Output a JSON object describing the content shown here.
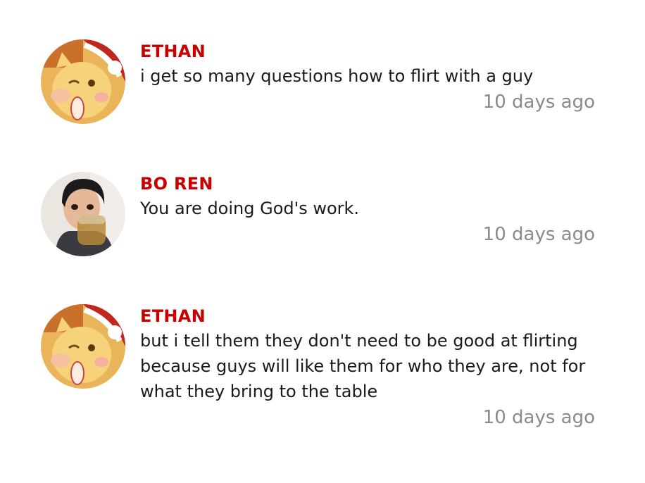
{
  "comments": [
    {
      "author": "ETHAN",
      "text": "i get so many questions how to flirt with a guy",
      "time": "10 days ago",
      "avatar": "cartoon-cat-santa-hat-icon"
    },
    {
      "author": "BO REN",
      "text": "You are doing God's work.",
      "time": "10 days ago",
      "avatar": "person-drinking-photo"
    },
    {
      "author": "ETHAN",
      "text": "but i tell them they don't need to be good at flirting because guys will like them for who they are, not for what they bring to the table",
      "time": "10 days ago",
      "avatar": "cartoon-cat-santa-hat-icon"
    }
  ],
  "colors": {
    "author": "#c80000",
    "text": "#1a1a1a",
    "time": "#8a8a8a"
  }
}
